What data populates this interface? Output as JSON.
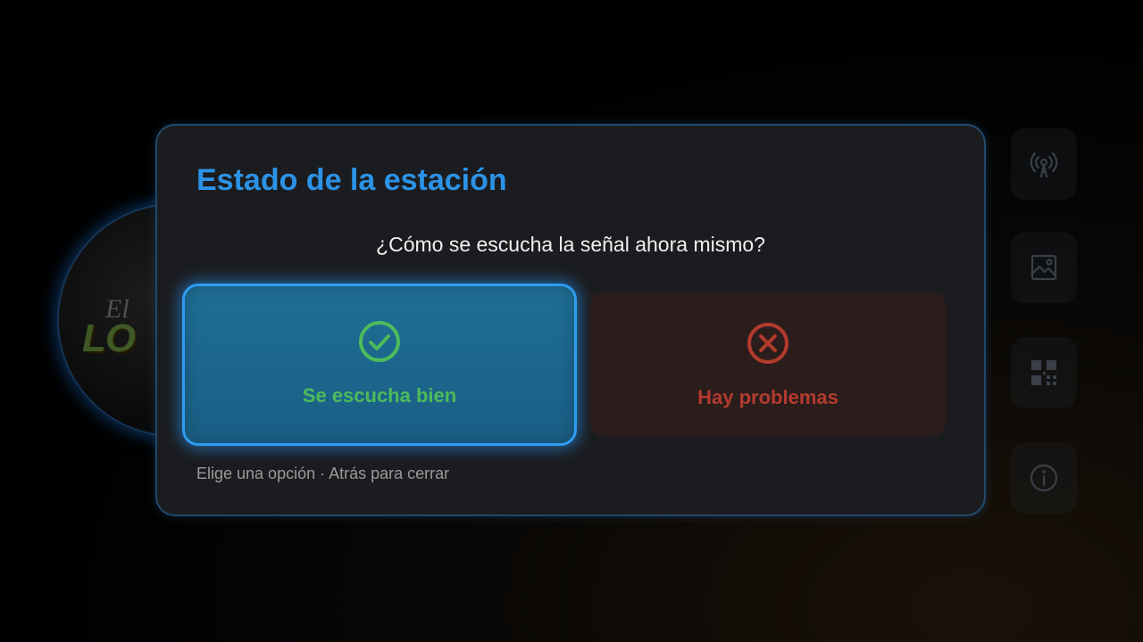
{
  "background": {
    "station_logo_text_top": "El",
    "station_logo_text_main": "LO",
    "rail_icons": [
      "broadcast-icon",
      "image-icon",
      "qr-code-icon",
      "info-icon"
    ]
  },
  "dialog": {
    "title": "Estado de la estación",
    "question": "¿Cómo se escucha la señal ahora mismo?",
    "option_ok": {
      "label": "Se escucha bien",
      "icon": "check-circle-icon",
      "color": "#4dbb5a",
      "focused": true
    },
    "option_bad": {
      "label": "Hay problemas",
      "icon": "x-circle-icon",
      "color": "#b33a2e",
      "focused": false
    },
    "hint": "Elige una opción · Atrás para cerrar",
    "accent_color": "#2c92e6"
  }
}
